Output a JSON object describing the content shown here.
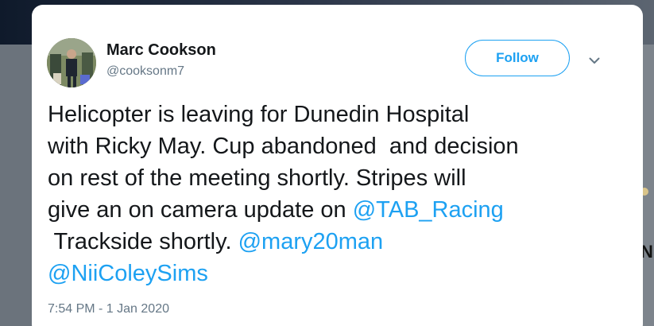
{
  "tweet": {
    "author_name": "Marc Cookson",
    "author_handle": "@cooksonm7",
    "follow_label": "Follow",
    "text_lines": [
      {
        "parts": [
          {
            "text": "Helicopter is leaving for Dunedin Hospital",
            "mention": false
          }
        ]
      },
      {
        "parts": [
          {
            "text": "with Ricky May. Cup abandoned  and decision",
            "mention": false
          }
        ]
      },
      {
        "parts": [
          {
            "text": "on rest of the meeting shortly. Stripes will",
            "mention": false
          }
        ]
      },
      {
        "parts": [
          {
            "text": "give an on camera update on ",
            "mention": false
          },
          {
            "text": "@TAB_Racing",
            "mention": true
          }
        ]
      },
      {
        "parts": [
          {
            "text": " Trackside shortly. ",
            "mention": false
          },
          {
            "text": "@mary20man",
            "mention": true
          }
        ]
      },
      {
        "parts": [
          {
            "text": "@NiiColeySims",
            "mention": true
          }
        ]
      }
    ],
    "timestamp": "7:54 PM - 1 Jan 2020"
  },
  "colors": {
    "accent": "#1da1f2",
    "text": "#14171a",
    "muted": "#657786"
  },
  "icons": {
    "caret": "chevron-down-icon",
    "avatar": "avatar"
  }
}
